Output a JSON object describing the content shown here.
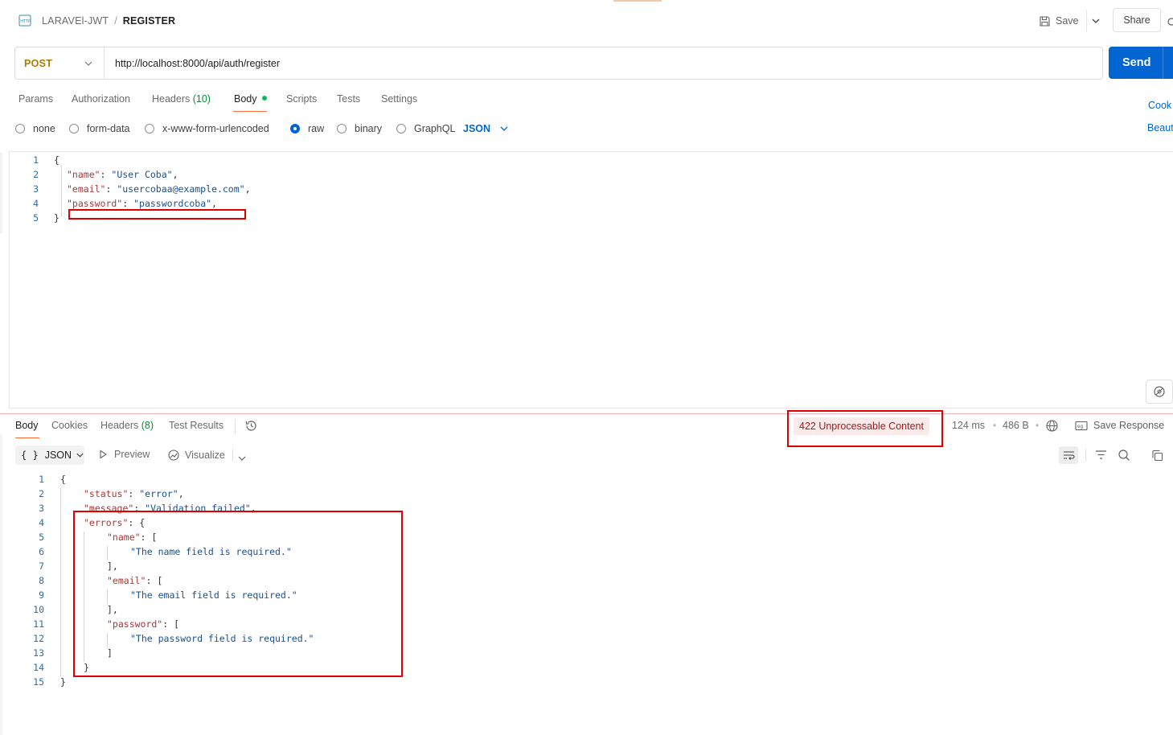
{
  "breadcrumb": {
    "parent": "LARAVEl-JWT",
    "separator": "/",
    "current": "REGISTER"
  },
  "header": {
    "save_label": "Save",
    "share_label": "Share"
  },
  "request": {
    "method": "POST",
    "url": "http://localhost:8000/api/auth/register",
    "send_label": "Send"
  },
  "request_tabs": {
    "params": "Params",
    "authorization": "Authorization",
    "headers": "Headers",
    "headers_count": "(10)",
    "body": "Body",
    "scripts": "Scripts",
    "tests": "Tests",
    "settings": "Settings",
    "cookies_link": "Cook",
    "beautify_link": "Beaut"
  },
  "body_types": {
    "none": "none",
    "form_data": "form-data",
    "urlencoded": "x-www-form-urlencoded",
    "raw": "raw",
    "binary": "binary",
    "graphql": "GraphQL",
    "selected_format": "JSON"
  },
  "request_body": {
    "line_numbers": [
      "1",
      "2",
      "3",
      "4",
      "5"
    ],
    "open": "{",
    "close": "}",
    "name_key": "\"name\"",
    "name_value": "\"User Coba\"",
    "email_key": "\"email\"",
    "email_value": "\"usercobaa@example.com\"",
    "password_key": "\"password\"",
    "password_value": "\"passwordcoba\"",
    "colon": ": ",
    "comma": ","
  },
  "response_tabs": {
    "body": "Body",
    "cookies": "Cookies",
    "headers": "Headers",
    "headers_count": "(8)",
    "test_results": "Test Results"
  },
  "response_meta": {
    "status": "422 Unprocessable Content",
    "time": "124 ms",
    "bullet": "•",
    "size": "486 B",
    "save_response": "Save Response"
  },
  "response_toolbar": {
    "format_braces": "{ }",
    "format": "JSON",
    "preview": "Preview",
    "visualize": "Visualize"
  },
  "response_body": {
    "line_numbers": [
      "1",
      "2",
      "3",
      "4",
      "5",
      "6",
      "7",
      "8",
      "9",
      "10",
      "11",
      "12",
      "13",
      "14",
      "15"
    ],
    "open": "{",
    "close": "}",
    "status_key": "\"status\"",
    "status_value": "\"error\"",
    "message_key": "\"message\"",
    "message_value": "\"Validation failed\"",
    "errors_key": "\"errors\"",
    "name_key": "\"name\"",
    "name_error": "\"The name field is required.\"",
    "email_key": "\"email\"",
    "email_error": "\"The email field is required.\"",
    "password_key": "\"password\"",
    "password_error": "\"The password field is required.\"",
    "open_obj": ": {",
    "open_arr": ": [",
    "close_arr_comma": "],",
    "close_arr": "]",
    "close_obj": "}",
    "colon": ": ",
    "comma": ","
  },
  "colors": {
    "send": "#0265d2",
    "method": "#ad7a03",
    "status_text": "#9c1a1a",
    "status_bg": "#fbeaea",
    "highlight": "#e00000",
    "active_tab": "#ff6c37",
    "json_key": "#a43a3a",
    "json_string": "#1c4f8c"
  }
}
